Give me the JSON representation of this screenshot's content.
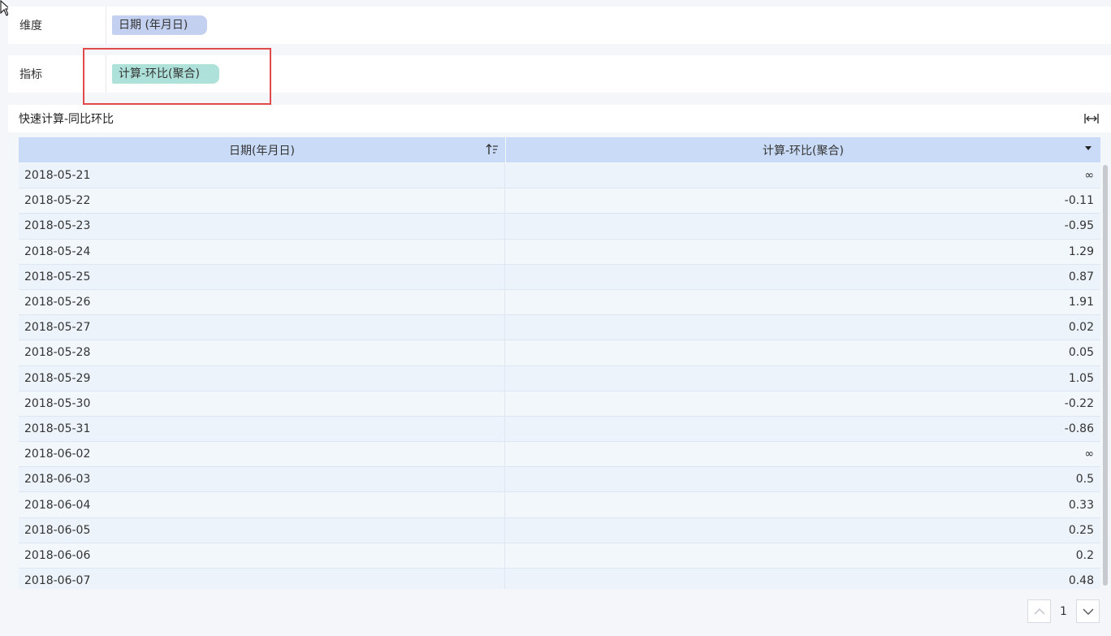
{
  "dimension_row": {
    "label": "维度",
    "chips": [
      {
        "text": "日期 (年月日)"
      }
    ]
  },
  "measure_row": {
    "label": "指标",
    "chips": [
      {
        "text": "计算-环比(聚合)"
      }
    ]
  },
  "panel": {
    "title": "快速计算-同比环比"
  },
  "table": {
    "columns": [
      "日期(年月日)",
      "计算-环比(聚合)"
    ],
    "rows": [
      [
        "2018-05-21",
        "∞"
      ],
      [
        "2018-05-22",
        "-0.11"
      ],
      [
        "2018-05-23",
        "-0.95"
      ],
      [
        "2018-05-24",
        "1.29"
      ],
      [
        "2018-05-25",
        "0.87"
      ],
      [
        "2018-05-26",
        "1.91"
      ],
      [
        "2018-05-27",
        "0.02"
      ],
      [
        "2018-05-28",
        "0.05"
      ],
      [
        "2018-05-29",
        "1.05"
      ],
      [
        "2018-05-30",
        "-0.22"
      ],
      [
        "2018-05-31",
        "-0.86"
      ],
      [
        "2018-06-02",
        "∞"
      ],
      [
        "2018-06-03",
        "0.5"
      ],
      [
        "2018-06-04",
        "0.33"
      ],
      [
        "2018-06-05",
        "0.25"
      ],
      [
        "2018-06-06",
        "0.2"
      ],
      [
        "2018-06-07",
        "0.48"
      ]
    ]
  },
  "pager": {
    "current_page": "1"
  },
  "colors": {
    "dimension_chip": "#c3d0ef",
    "measure_chip": "#aee1d9",
    "header_bg": "#c9dbf6",
    "highlight": "#e04a4a"
  }
}
